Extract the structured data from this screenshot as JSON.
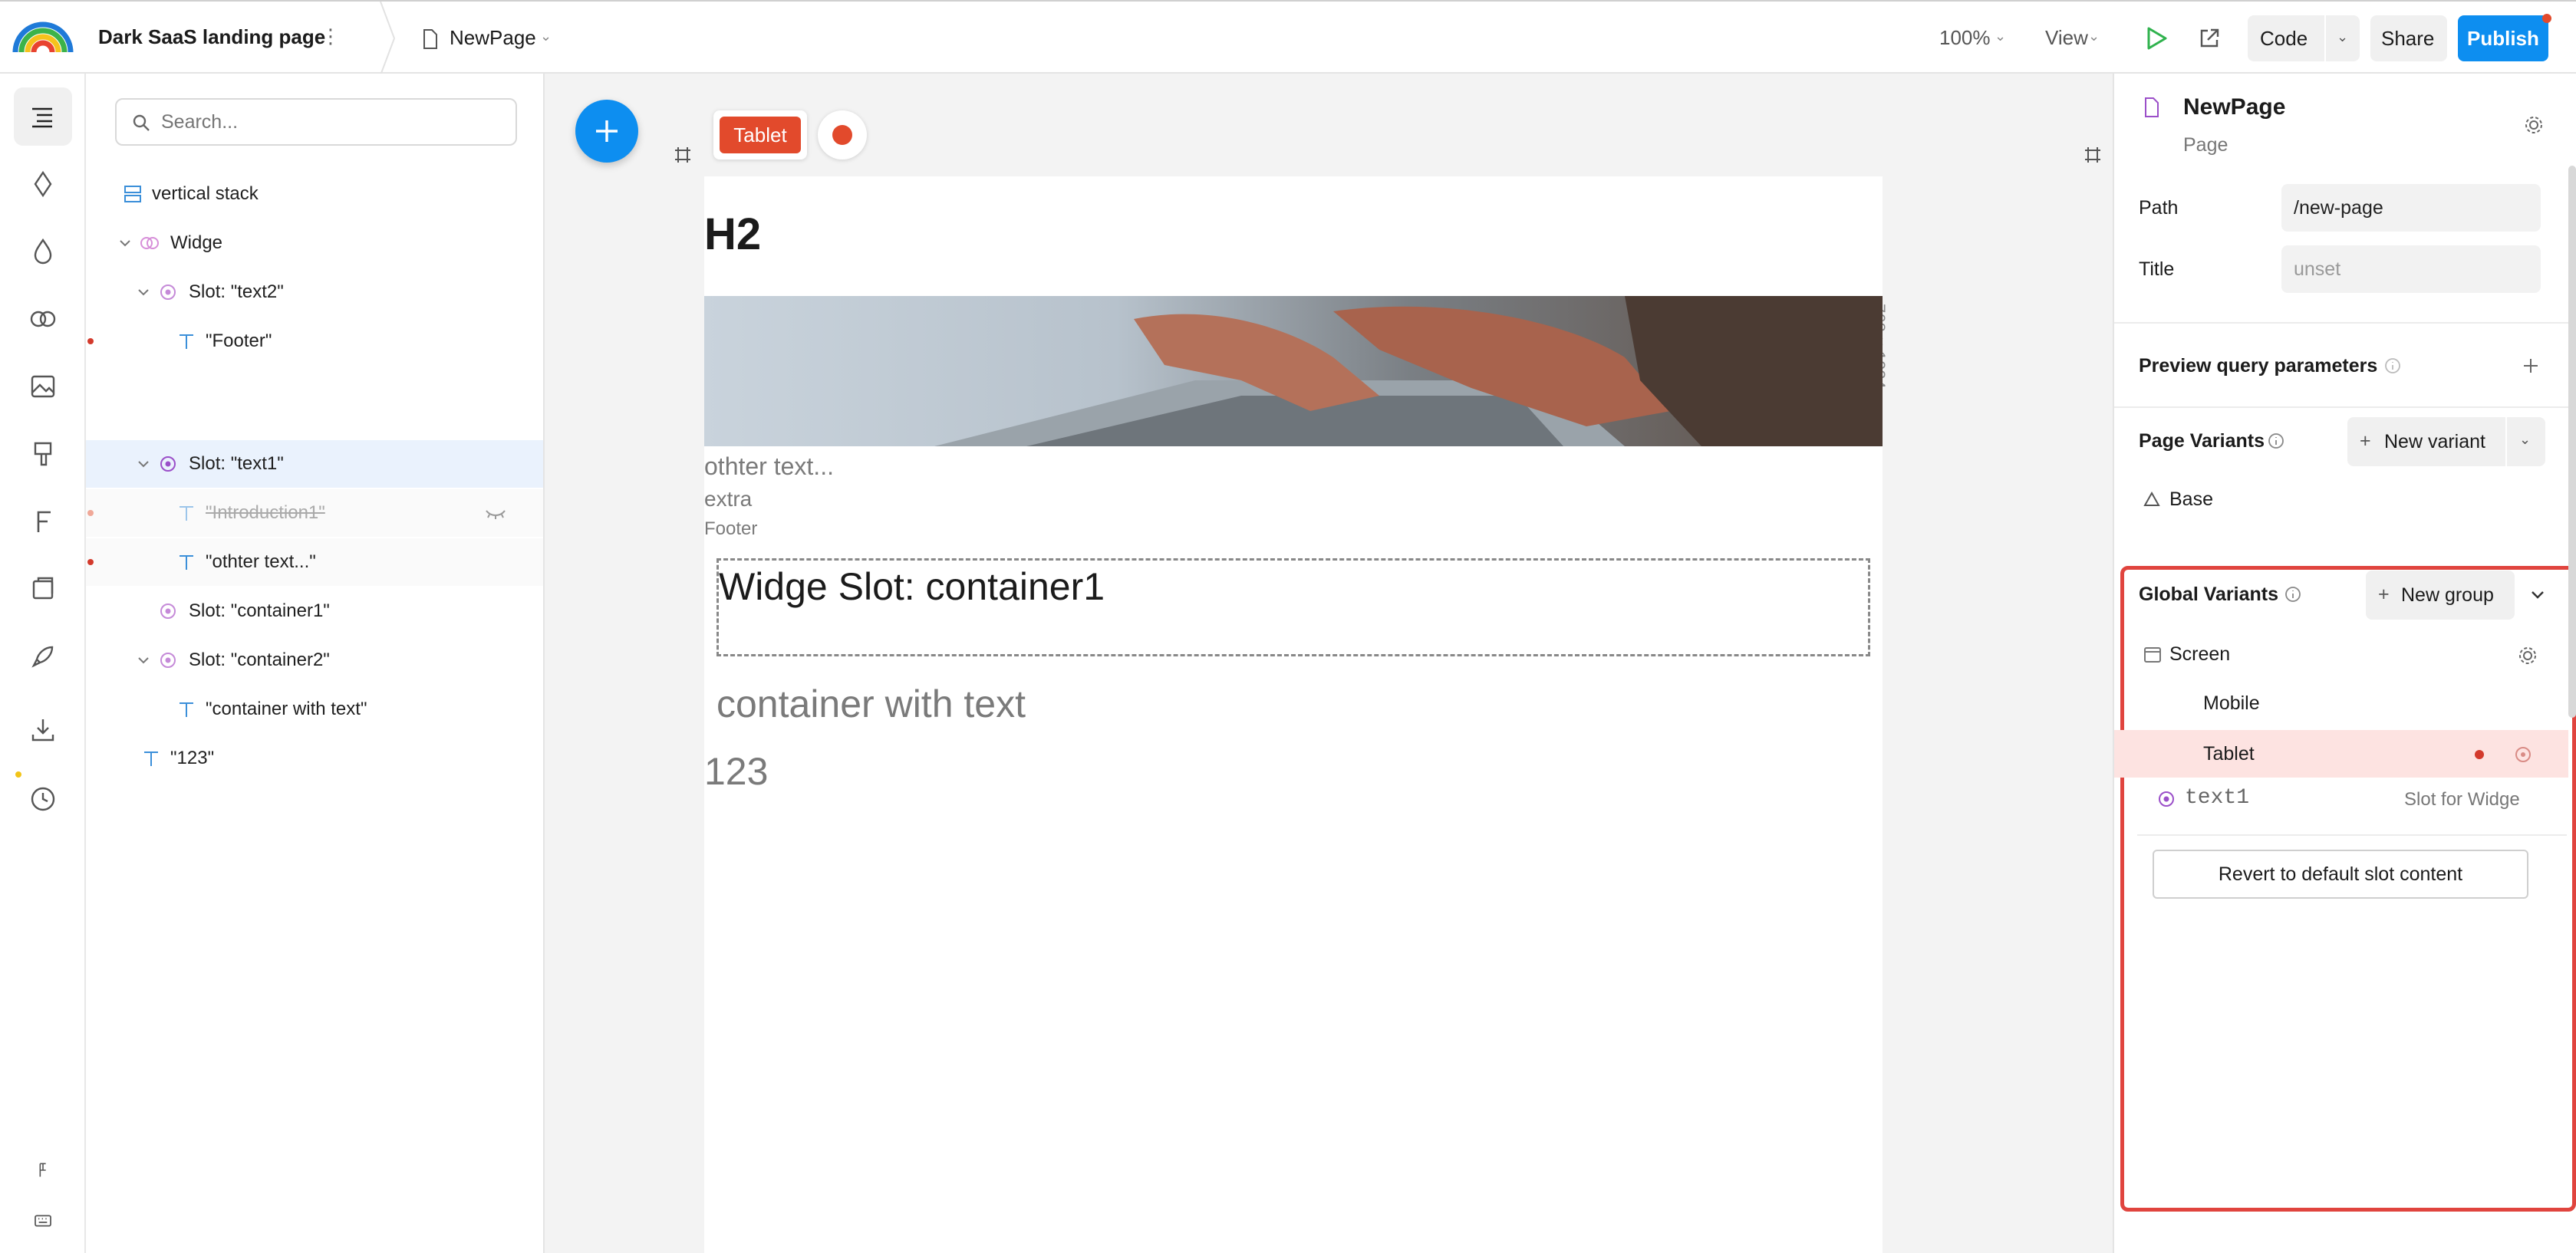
{
  "topbar": {
    "project_title": "Dark SaaS landing page",
    "page_name": "NewPage",
    "zoom": "100%",
    "view_label": "View",
    "code_label": "Code",
    "share_label": "Share",
    "publish_label": "Publish"
  },
  "tree": {
    "search_placeholder": "Search...",
    "rows": [
      {
        "label": "vertical stack"
      },
      {
        "label": "Widge"
      },
      {
        "label": "Slot: \"text2\""
      },
      {
        "label": "\"Footer\""
      },
      {
        "label": "Slot: \"text1\""
      },
      {
        "label": "\"Introduction1\""
      },
      {
        "label": "\"othter text...\""
      },
      {
        "label": "Slot: \"container1\""
      },
      {
        "label": "Slot: \"container2\""
      },
      {
        "label": "\"container with text\""
      },
      {
        "label": "\"123\""
      }
    ]
  },
  "canvas": {
    "variant_badge": "Tablet",
    "dimension_label": "768 × 1024",
    "h2": "H2",
    "other_text": "othter text...",
    "extra": "extra",
    "footer": "Footer",
    "slot_container1": "Widge Slot: container1",
    "container_text": "container with text",
    "number_text": "123"
  },
  "right_panel": {
    "page_name": "NewPage",
    "page_type": "Page",
    "path_label": "Path",
    "path_value": "/new-page",
    "title_label": "Title",
    "title_placeholder": "unset",
    "preview_query_label": "Preview query parameters",
    "page_variants_label": "Page Variants",
    "new_variant_label": "New variant",
    "base_label": "Base",
    "global_variants_label": "Global Variants",
    "new_group_label": "New group",
    "screen_label": "Screen",
    "mobile_label": "Mobile",
    "tablet_label": "Tablet",
    "slot_name": "text1",
    "slot_for": "Slot for Widge",
    "revert_label": "Revert to default slot content"
  },
  "colors": {
    "accent": "#0d8ef0",
    "record": "#e24a2c",
    "highlight": "#e0443e",
    "selected_row": "#eaf2fd",
    "tablet_row": "#fde3e1"
  }
}
